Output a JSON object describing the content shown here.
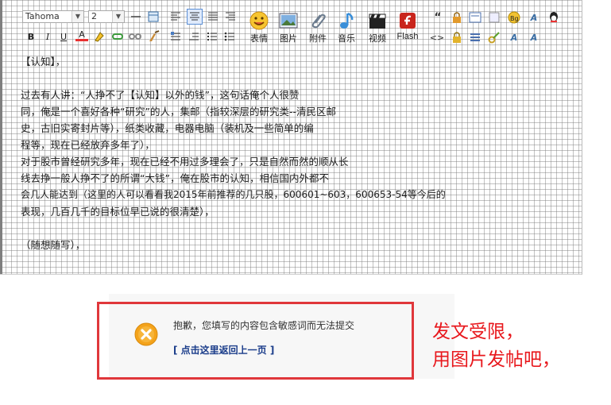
{
  "toolbar": {
    "font_family": "Tahoma",
    "font_size": "2",
    "buttons": {
      "emoticon": "表情",
      "image": "图片",
      "attachment": "附件",
      "music": "音乐",
      "video": "视频",
      "flash": "Flash"
    }
  },
  "editor": {
    "lines": [
      "【认知】，",
      "",
      "过去有人讲：“人挣不了【认知】以外的钱”，这句话俺个人很赞",
      "同，俺是一个喜好各种“研究”的人，集邮（指较深层的研究类--清民区邮",
      "史，古旧实寄封片等），纸类收藏，电器电脑（装机及一些简单的编",
      "程等，现在已经放弃多年了），",
      "对于股市曾经研究多年，现在已经不用过多理会了，只是自然而然的顺从长",
      "线去挣一般人挣不了的所谓“大钱”，俺在股市的认知，相信国内外都不",
      "会几人能达到（这里的人可以看看我2015年前推荐的几只股，600601~603，600653-54等今后的",
      "表现，几百几千的目标位早已说的很清楚），",
      "",
      "（随想随写），"
    ]
  },
  "dialog": {
    "message": "抱歉，您填写的内容包含敏感词而无法提交",
    "back_link": "[ 点击这里返回上一页 ]"
  },
  "note": {
    "line1": "发文受限，",
    "line2": "用图片发帖吧，"
  },
  "colors": {
    "frame": "#e0373b",
    "note": "#e8181d",
    "link": "#1a3c8a",
    "error_icon": "#f4a31b"
  }
}
